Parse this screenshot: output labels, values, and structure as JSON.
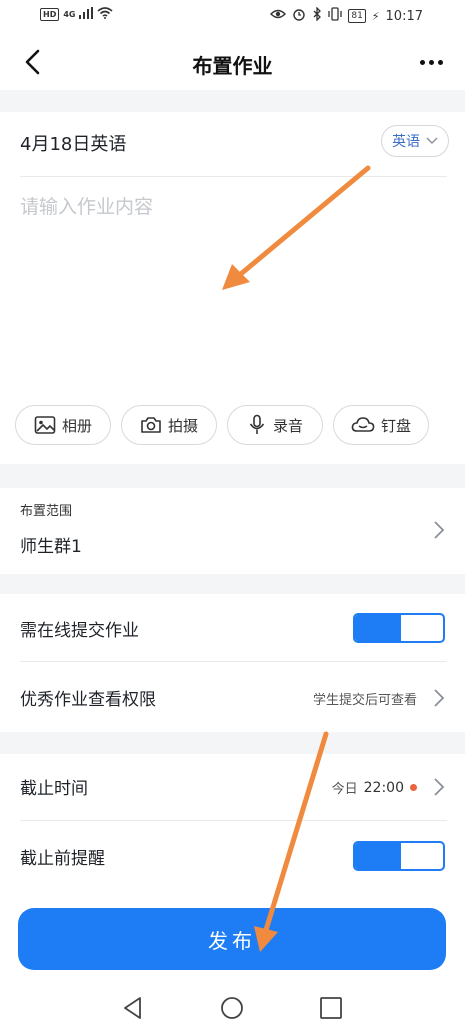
{
  "status_bar": {
    "left_badges": [
      "HD",
      "4G"
    ],
    "battery": "81",
    "time": "10:17"
  },
  "nav": {
    "title": "布置作业"
  },
  "homework": {
    "title": "4月18日英语",
    "subject": "英语",
    "content_placeholder": "请输入作业内容"
  },
  "attachments": [
    {
      "label": "相册",
      "icon": "image-icon"
    },
    {
      "label": "拍摄",
      "icon": "camera-icon"
    },
    {
      "label": "录音",
      "icon": "microphone-icon"
    },
    {
      "label": "钉盘",
      "icon": "cloud-icon"
    }
  ],
  "scope": {
    "label": "布置范围",
    "value": "师生群1"
  },
  "online_submit": {
    "label": "需在线提交作业",
    "enabled": true
  },
  "excellent_view": {
    "label": "优秀作业查看权限",
    "value": "学生提交后可查看"
  },
  "deadline": {
    "label": "截止时间",
    "day": "今日",
    "time": "22:00"
  },
  "reminder": {
    "label": "截止前提醒",
    "enabled": true
  },
  "publish": {
    "label": "发布"
  },
  "colors": {
    "accent": "#1e7df4",
    "arrow": "#f08a3e",
    "deadline_dot": "#e8643c"
  }
}
